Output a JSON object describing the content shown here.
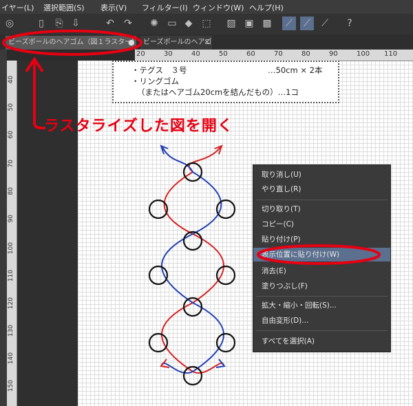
{
  "menubar": {
    "items": [
      "イヤー(L)",
      "選択範囲(S)",
      "表示(V)",
      "フィルター(I)",
      "ウィンドウ(W)",
      "ヘルプ(H)"
    ]
  },
  "tabs": [
    {
      "label": "ビーズボールのヘアゴム（図１ラスター）*",
      "close": "●"
    },
    {
      "label": "ビーズボールのヘアゴ",
      "close": "×"
    }
  ],
  "hruler": {
    "ticks": [
      "20",
      "30",
      "40",
      "50",
      "60",
      "70",
      "80",
      "90",
      "100",
      "110"
    ]
  },
  "vruler": {
    "ticks": [
      "40",
      "50",
      "60",
      "70",
      "80",
      "90",
      "100",
      "110",
      "120",
      "130",
      "140",
      "150"
    ]
  },
  "materials": {
    "line1_left": "・テグス　３号",
    "line1_right": "…50cm × 2本",
    "line2": "・リングゴム",
    "line3": "（またはヘアゴム20cmを結んだもの）…1コ"
  },
  "annotation": "ラスタライズした図を開く",
  "context_menu": {
    "items": [
      "取り消し(U)",
      "やり直し(R)",
      "切り取り(T)",
      "コピー(C)",
      "貼り付け(P)",
      "表示位置に貼り付け(W)",
      "消去(E)",
      "塗りつぶし(F)",
      "拡大・縮小・回転(S)...",
      "自由変形(D)...",
      "すべてを選択(A)"
    ],
    "highlighted": "表示位置に貼り付け(W)"
  },
  "colors": {
    "annotation_red": "#e60012",
    "strand_red": "#d62020",
    "strand_blue": "#1f3fb4",
    "highlight": "#5b6f8f"
  }
}
